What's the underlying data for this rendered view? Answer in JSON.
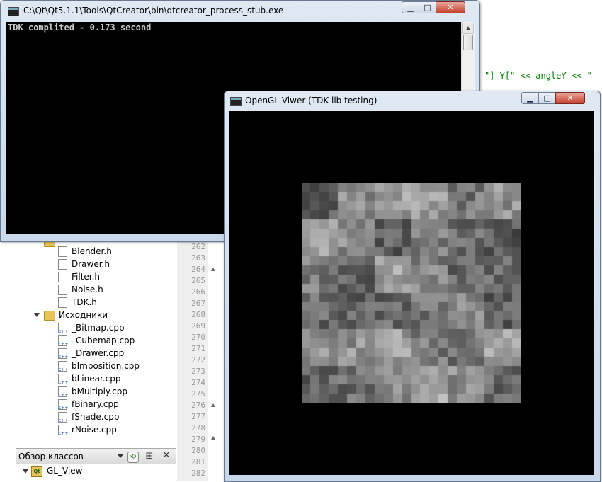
{
  "console_window": {
    "title": "C:\\Qt\\Qt5.1.1\\Tools\\QtCreator\\bin\\qtcreator_process_stub.exe",
    "output": "TDK complited - 0.173 second",
    "minimize_label": "▁",
    "maximize_label": "□",
    "close_label": "✕"
  },
  "gl_window": {
    "title": "OpenGL Viwer (TDK lib testing)",
    "minimize_label": "▁",
    "maximize_label": "□",
    "close_label": "✕",
    "texture_rows": 24,
    "texture_cols": 24
  },
  "editor": {
    "code_snippet": "\"] Y[\" << angleY << \"",
    "line_numbers": [
      "262",
      "263",
      "264",
      "265",
      "266",
      "267",
      "268",
      "269",
      "270",
      "271",
      "272",
      "273",
      "274",
      "275",
      "276",
      "277",
      "278",
      "279",
      "280",
      "281",
      "282"
    ]
  },
  "project_tree": {
    "headers": [
      "Blender.h",
      "Drawer.h",
      "Filter.h",
      "Noise.h",
      "TDK.h"
    ],
    "sources_folder": "Исходники",
    "sources": [
      "_Bitmap.cpp",
      "_Cubemap.cpp",
      "_Drawer.cpp",
      "bImposition.cpp",
      "bLinear.cpp",
      "bMultiply.cpp",
      "fBinary.cpp",
      "fShade.cpp",
      "rNoise.cpp"
    ]
  },
  "class_view": {
    "title": "Обзор классов",
    "root_item": "GL_View"
  },
  "colors": {
    "console_bg": "#000000",
    "console_text": "#c8c8c8",
    "code_string": "#008000",
    "line_number": "#9a9a9a"
  }
}
